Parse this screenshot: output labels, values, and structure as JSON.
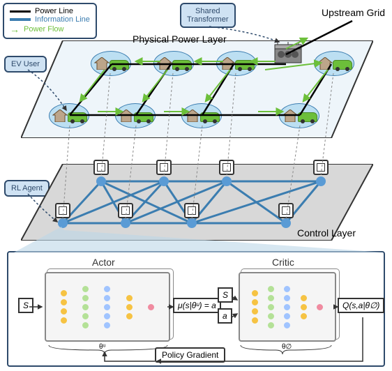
{
  "legend": {
    "power_line": "Power Line",
    "info_line": "Information Line",
    "power_flow": "Power Flow"
  },
  "callouts": {
    "transformer": "Shared\nTransformer",
    "ev_user": "EV User",
    "rl_agent": "RL Agent"
  },
  "labels": {
    "upstream": "Upstream Grid",
    "physical": "Physical Power Layer",
    "control": "Control Layer",
    "actor": "Actor",
    "critic": "Critic",
    "pg": "Policy Gradient"
  },
  "io": {
    "s": "S",
    "a": "a",
    "actor_out": "μ(s|θᵘ) = a",
    "critic_out": "Q(s,a|θ∅)",
    "theta_mu": "θᵘ",
    "theta_q": "θ∅"
  },
  "colors": {
    "power_line": "#000000",
    "info_line": "#3b7db0",
    "flow_arrow": "#6cbf3a",
    "accent": "#2e4a6b",
    "node_bg": "#bcdff2"
  },
  "counts": {
    "physical_nodes": 8,
    "control_agents": 8
  }
}
